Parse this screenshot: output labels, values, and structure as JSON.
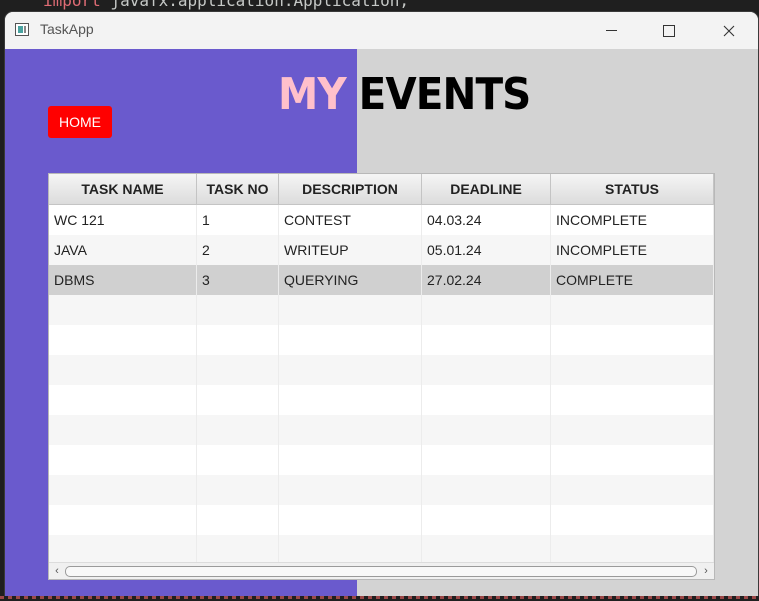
{
  "editor": {
    "keyword": "import",
    "code_rest": " javafx.application.Application;"
  },
  "window": {
    "title": "TaskApp"
  },
  "heading": {
    "part1": "MY",
    "part2": "EVENTS"
  },
  "home_button": "HOME",
  "table": {
    "columns": [
      "TASK NAME",
      "TASK NO",
      "DESCRIPTION",
      "DEADLINE",
      "STATUS"
    ],
    "rows": [
      [
        "WC 121",
        "1",
        "CONTEST",
        "04.03.24",
        "INCOMPLETE"
      ],
      [
        "JAVA",
        "2",
        "WRITEUP",
        "05.01.24",
        "INCOMPLETE"
      ],
      [
        "DBMS",
        "3",
        "QUERYING",
        "27.02.24",
        "COMPLETE"
      ]
    ],
    "selected_row": 2,
    "empty_rows": 9
  },
  "colors": {
    "panel": "#6a5acd",
    "background": "#d3d3d3",
    "home_button": "#ff0000",
    "heading_my": "#ffc0cb",
    "heading_events": "#000000"
  },
  "icons": {
    "app": "app-window-icon",
    "minimize": "minimize-icon",
    "maximize": "maximize-icon",
    "close": "close-icon",
    "scroll_left": "chevron-left-icon",
    "scroll_right": "chevron-right-icon"
  }
}
